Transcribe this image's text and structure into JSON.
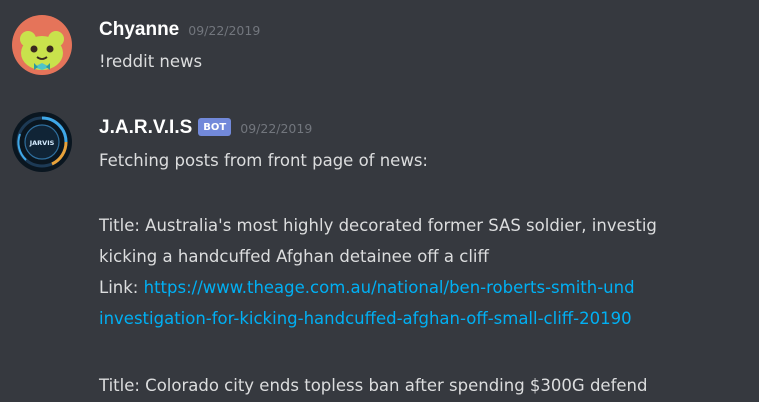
{
  "messages": [
    {
      "author": "Chyanne",
      "timestamp": "09/22/2019",
      "avatar_icon": "green-frog-character-avatar",
      "content": "!reddit news"
    },
    {
      "author": "J.A.R.V.I.S",
      "bot_tag": "BOT",
      "timestamp": "09/22/2019",
      "avatar_icon": "jarvis-circular-logo-avatar",
      "avatar_text": "JARVIS",
      "intro": "Fetching posts from front page of news:",
      "posts": [
        {
          "title_label": "Title:",
          "title_line1": "Australia's most highly decorated former SAS soldier, investig",
          "title_line2": "kicking a handcuffed Afghan detainee off a cliff",
          "link_label": "Link:",
          "link_line1": "https://www.theage.com.au/national/ben-roberts-smith-und",
          "link_line2": "investigation-for-kicking-handcuffed-afghan-off-small-cliff-20190"
        },
        {
          "title_label": "Title:",
          "title_line1": "Colorado city ends topless ban after spending $300G defend"
        }
      ]
    }
  ],
  "colors": {
    "background": "#36393f",
    "username": "#ffffff",
    "text": "#dcddde",
    "timestamp": "#72767d",
    "link": "#00b0f4",
    "bot_tag": "#7289da"
  }
}
